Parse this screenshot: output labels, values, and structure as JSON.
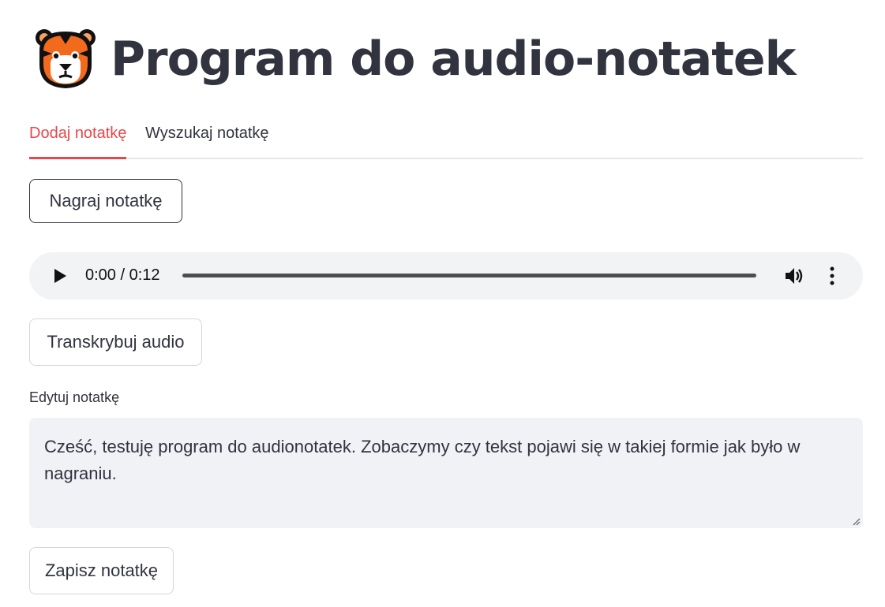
{
  "app": {
    "title": "Program do audio-notatek",
    "logo_icon": "tiger-face-icon"
  },
  "tabs": [
    {
      "label": "Dodaj notatkę",
      "active": true
    },
    {
      "label": "Wyszukaj notatkę",
      "active": false
    }
  ],
  "buttons": {
    "record": "Nagraj notatkę",
    "transcribe": "Transkrybuj audio",
    "save": "Zapisz notatkę"
  },
  "audio_player": {
    "time": "0:00 / 0:12",
    "icons": [
      "play-icon",
      "volume-icon",
      "more-options-icon"
    ]
  },
  "editor": {
    "label": "Edytuj notatkę",
    "value": "Cześć, testuję program do audionotatek. Zobaczymy czy tekst pojawi się w takiej formie jak było w nagraniu."
  },
  "colors": {
    "accent": "#e8474a",
    "text": "#31333f",
    "field_bg": "#f0f2f6"
  }
}
